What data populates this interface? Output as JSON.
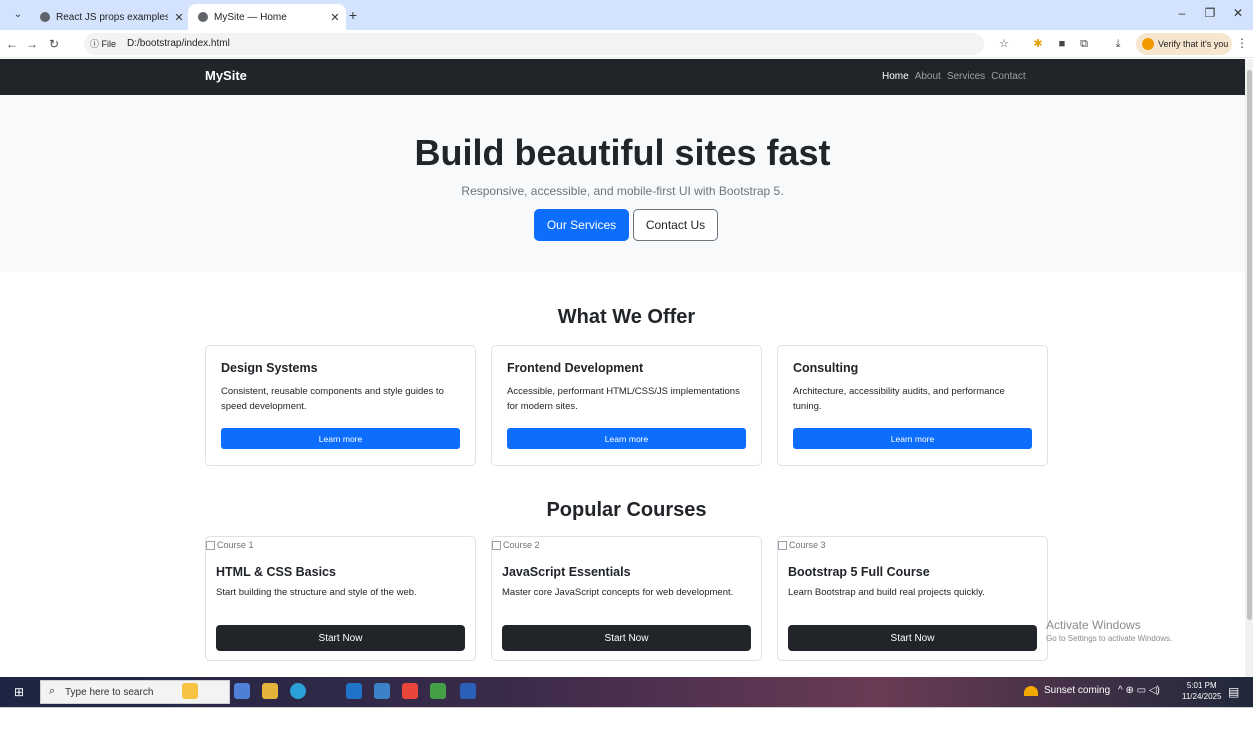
{
  "browser": {
    "tabs": [
      {
        "title": "React JS props examples",
        "active": false
      },
      {
        "title": "MySite — Home",
        "active": true
      }
    ],
    "new_tab": "+",
    "address": {
      "info_label": "ⓘ File",
      "url": "D:/bootstrap/index.html"
    },
    "verify_label": "Verify that it's you"
  },
  "site": {
    "brand": "MySite",
    "nav": [
      "Home",
      "About",
      "Services",
      "Contact"
    ],
    "hero": {
      "title": "Build beautiful sites fast",
      "subtitle": "Responsive, accessible, and mobile-first UI with Bootstrap 5.",
      "primary_button": "Our Services",
      "secondary_button": "Contact Us"
    },
    "offer": {
      "title": "What We Offer",
      "cards": [
        {
          "title": "Design Systems",
          "text": "Consistent, reusable components and style guides to speed development.",
          "button": "Learn more"
        },
        {
          "title": "Frontend Development",
          "text": "Accessible, performant HTML/CSS/JS implementations for modern sites.",
          "button": "Learn more"
        },
        {
          "title": "Consulting",
          "text": "Architecture, accessibility audits, and performance tuning.",
          "button": "Learn more"
        }
      ]
    },
    "courses": {
      "title": "Popular Courses",
      "items": [
        {
          "alt": "Course 1",
          "title": "HTML & CSS Basics",
          "text": "Start building the structure and style of the web.",
          "button": "Start Now"
        },
        {
          "alt": "Course 2",
          "title": "JavaScript Essentials",
          "text": "Master core JavaScript concepts for web development.",
          "button": "Start Now"
        },
        {
          "alt": "Course 3",
          "title": "Bootstrap 5 Full Course",
          "text": "Learn Bootstrap and build real projects quickly.",
          "button": "Start Now"
        }
      ]
    }
  },
  "watermark": {
    "line1": "Activate Windows",
    "line2": "Go to Settings to activate Windows."
  },
  "taskbar": {
    "search_placeholder": "Type here to search",
    "weather": "Sunset coming",
    "time": "5:01 PM",
    "date": "11/24/2025"
  },
  "colors": {
    "primary": "#0d6efd",
    "dark": "#212529",
    "hero_bg": "#f8f9fa"
  }
}
